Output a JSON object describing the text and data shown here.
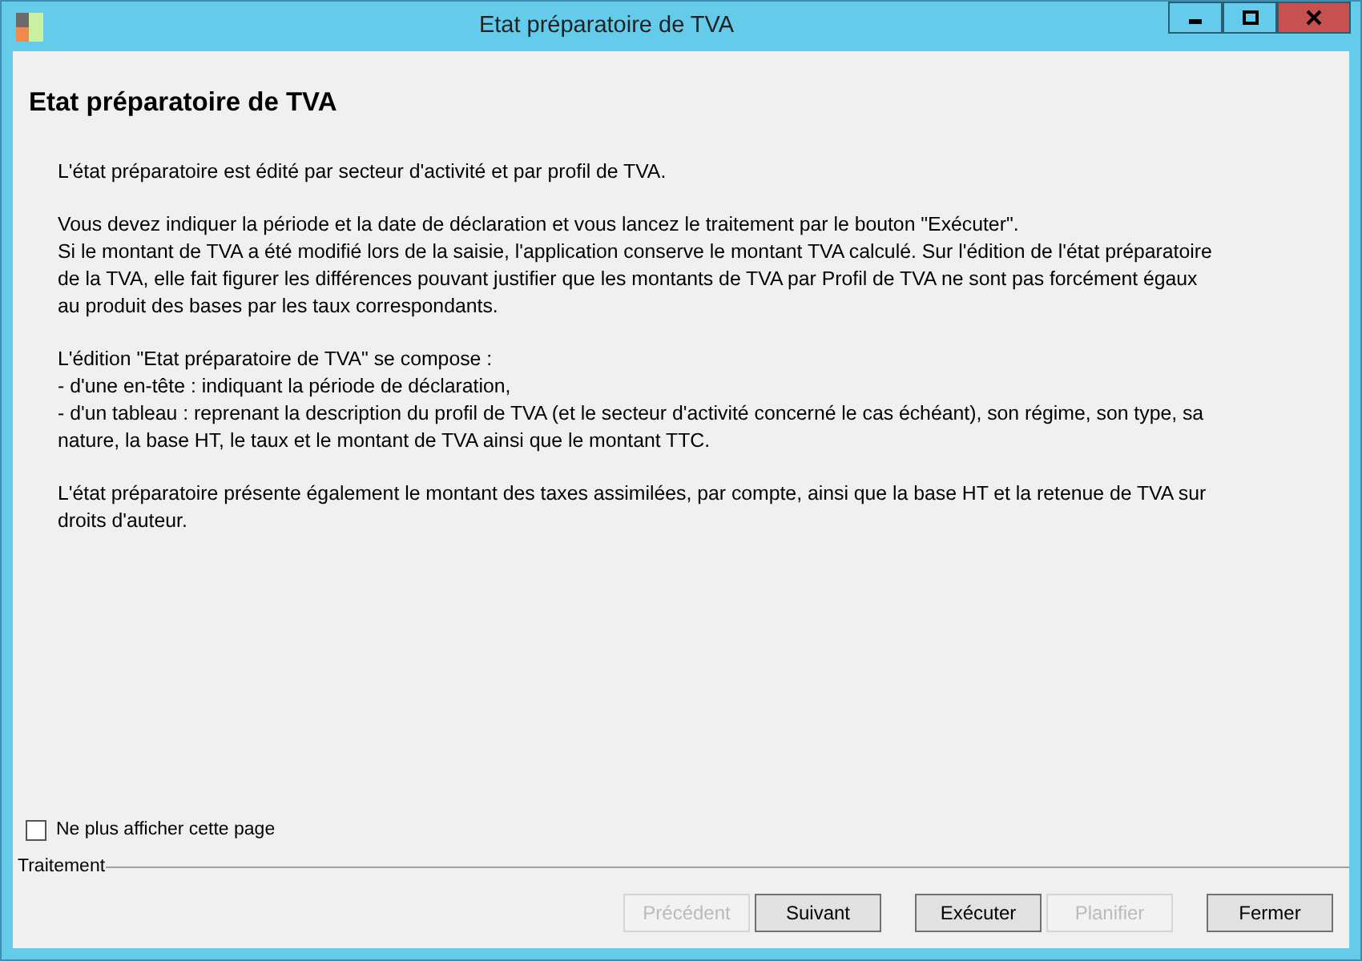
{
  "window": {
    "title": "Etat préparatoire de TVA"
  },
  "heading": "Etat préparatoire de TVA",
  "paragraphs": [
    [
      "L'état préparatoire est édité par secteur d'activité et par profil de TVA."
    ],
    [
      "Vous devez indiquer la période et la date de déclaration et vous lancez le traitement par le bouton \"Exécuter\".",
      "Si le montant de TVA a été modifié lors de la saisie, l'application conserve le montant TVA calculé. Sur l'édition de l'état préparatoire",
      "de la TVA, elle fait figurer les différences pouvant justifier que les montants de TVA par Profil de TVA ne sont pas forcément égaux",
      "au produit des bases par les taux correspondants."
    ],
    [
      "L'édition \"Etat préparatoire de TVA\" se compose :",
      "- d'une en-tête : indiquant la période de déclaration,",
      "- d'un tableau : reprenant la description du profil de TVA (et le secteur d'activité concerné le cas échéant), son régime, son type, sa",
      "nature, la base HT, le taux et le montant de TVA ainsi que le montant TTC."
    ],
    [
      "L'état préparatoire présente également le montant des taxes assimilées, par compte, ainsi que la base HT et la retenue de TVA sur",
      "droits d'auteur."
    ]
  ],
  "checkbox": {
    "label": "Ne plus afficher cette page",
    "checked": false
  },
  "group_label": "Traitement",
  "buttons": [
    {
      "label": "Précédent",
      "disabled": true
    },
    {
      "label": "Suivant",
      "disabled": false
    },
    {
      "label": "Exécuter",
      "disabled": false
    },
    {
      "label": "Planifier",
      "disabled": true
    },
    {
      "label": "Fermer",
      "disabled": false
    }
  ]
}
